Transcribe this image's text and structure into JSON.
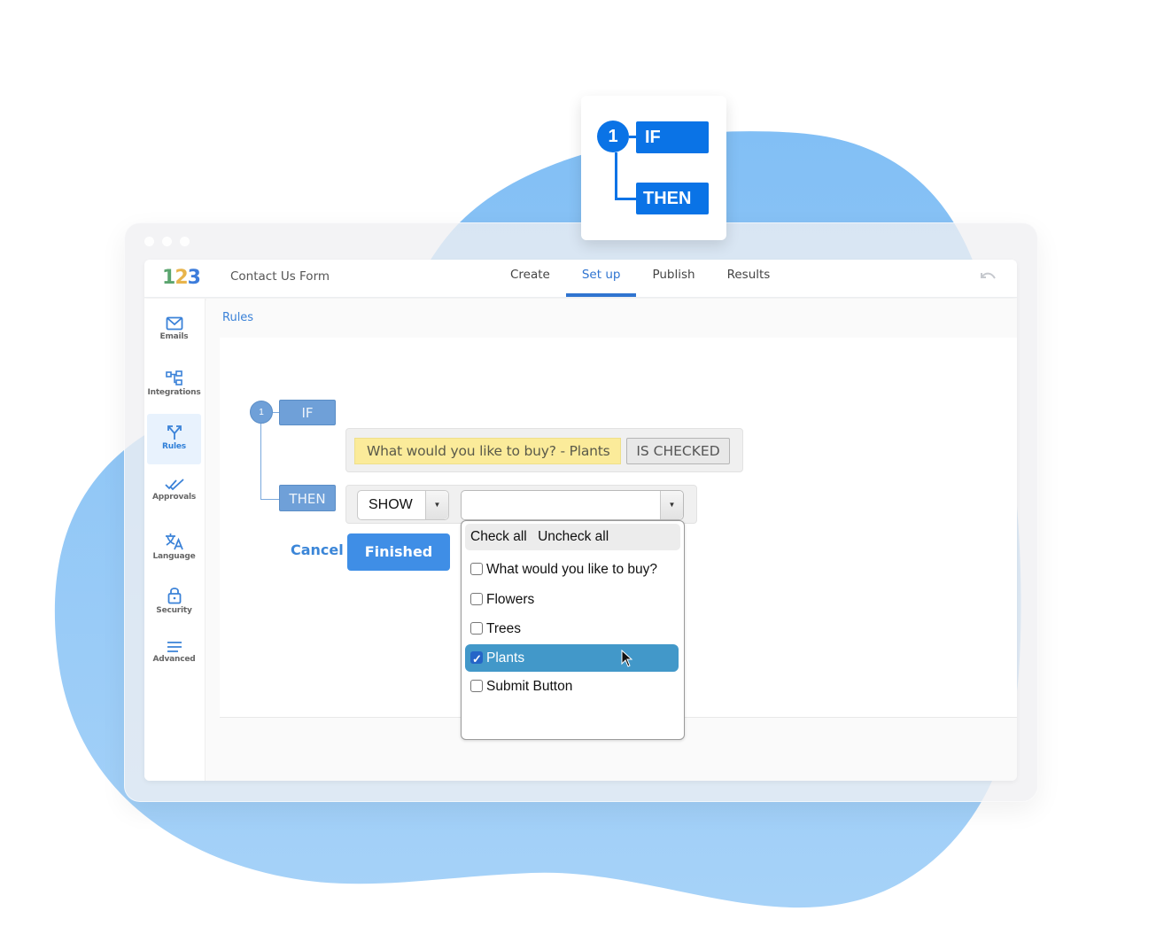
{
  "colors": {
    "brand_blue": "#2f74d0",
    "blob_blue": "#8ec5f5",
    "rule_tag_blue": "#6fa0d8",
    "card_blue": "#0a73e6",
    "condition_yellow": "#fbeb9a",
    "selected_item": "#4298c9",
    "finished_button": "#3f8ee6"
  },
  "rule_card": {
    "number": "1",
    "if_label": "IF",
    "then_label": "THEN"
  },
  "header": {
    "logo": [
      "1",
      "2",
      "3"
    ],
    "form_title": "Contact Us Form",
    "tabs": [
      {
        "label": "Create",
        "active": false
      },
      {
        "label": "Set up",
        "active": true
      },
      {
        "label": "Publish",
        "active": false
      },
      {
        "label": "Results",
        "active": false
      }
    ],
    "undo_icon": "undo-icon"
  },
  "sidebar": {
    "items": [
      {
        "label": "Emails",
        "icon": "envelope-icon",
        "active": false
      },
      {
        "label": "Integrations",
        "icon": "integrations-icon",
        "active": false
      },
      {
        "label": "Rules",
        "icon": "rules-split-icon",
        "active": true
      },
      {
        "label": "Approvals",
        "icon": "double-check-icon",
        "active": false
      },
      {
        "label": "Language",
        "icon": "translate-icon",
        "active": false
      },
      {
        "label": "Security",
        "icon": "lock-icon",
        "active": false
      },
      {
        "label": "Advanced",
        "icon": "menu-lines-icon",
        "active": false
      }
    ]
  },
  "breadcrumb": "Rules",
  "rule": {
    "number": "1",
    "if_label": "IF",
    "then_label": "THEN",
    "condition_field": "What would you like to buy? - Plants",
    "condition_operator": "IS CHECKED",
    "action_value": "SHOW",
    "target_value": ""
  },
  "dropdown": {
    "check_all": "Check all",
    "uncheck_all": "Uncheck all",
    "options": [
      {
        "label": "What would you like to buy?",
        "checked": false
      },
      {
        "label": "Flowers",
        "checked": false
      },
      {
        "label": "Trees",
        "checked": false
      },
      {
        "label": "Plants",
        "checked": true
      },
      {
        "label": "Submit Button",
        "checked": false
      }
    ]
  },
  "actions": {
    "cancel": "Cancel",
    "finished": "Finished"
  }
}
